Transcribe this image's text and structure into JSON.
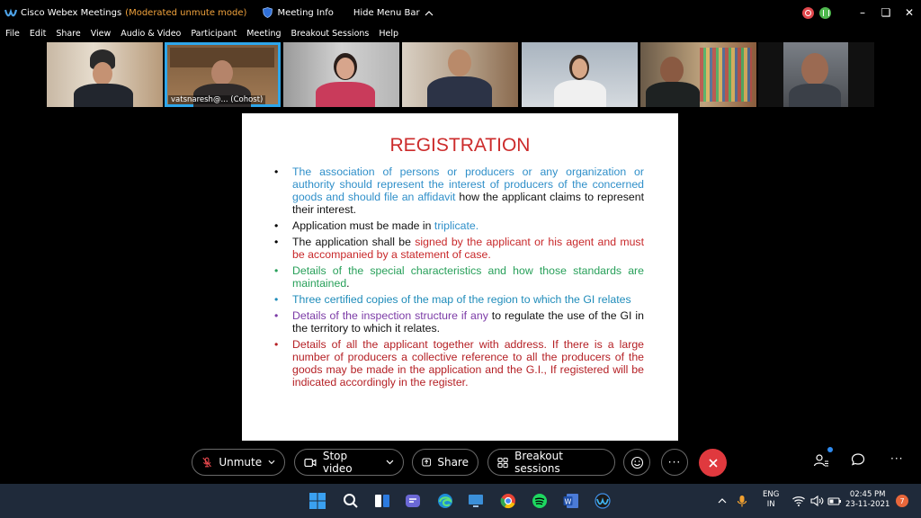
{
  "app": {
    "title": "Cisco Webex Meetings",
    "mode": "(Moderated unmute mode)",
    "meeting_info": "Meeting Info",
    "hide_menu": "Hide Menu Bar"
  },
  "menu": [
    "File",
    "Edit",
    "Share",
    "View",
    "Audio & Video",
    "Participant",
    "Meeting",
    "Breakout Sessions",
    "Help"
  ],
  "participants": {
    "active_label": "vatsnaresh@... (Cohost)"
  },
  "slide": {
    "title": "REGISTRATION",
    "bullets": [
      {
        "parts": [
          {
            "text": "The association of persons or producers or any organization or authority should represent the interest of producers of the concerned goods and should file an affidavit ",
            "color": "#2f8fc9"
          },
          {
            "text": "how the applicant claims to represent their interest.",
            "color": "#111111"
          }
        ]
      },
      {
        "parts": [
          {
            "text": "Application must be made in ",
            "color": "#111111"
          },
          {
            "text": "triplicate.",
            "color": "#2f8fc9"
          }
        ]
      },
      {
        "parts": [
          {
            "text": "The application shall be ",
            "color": "#111111"
          },
          {
            "text": "signed by the applicant or his agent and must be accompanied by a statement of case.",
            "color": "#c8282a"
          }
        ]
      },
      {
        "parts": [
          {
            "text": "Details of the special characteristics and how those standards are maintained",
            "color": "#28a05a"
          },
          {
            "text": ".",
            "color": "#111111"
          }
        ]
      },
      {
        "parts": [
          {
            "text": "Three certified copies of the map of the region to which the GI relates",
            "color": "#1f8cba"
          }
        ]
      },
      {
        "parts": [
          {
            "text": "Details of the inspection structure if any ",
            "color": "#7b3aa6"
          },
          {
            "text": "to regulate the use of the GI in the territory to which it relates.",
            "color": "#111111"
          }
        ]
      },
      {
        "parts": [
          {
            "text": "Details of all the applicant together with address. If there is a large number of producers a collective reference to all the producers of the goods may be made in the application and the G.I., If registered will be indicated accordingly in the register.",
            "color": "#b52025"
          }
        ]
      }
    ]
  },
  "controls": {
    "unmute": "Unmute",
    "stop_video": "Stop video",
    "share": "Share",
    "breakout": "Breakout sessions"
  },
  "taskbar": {
    "lang_line1": "ENG",
    "lang_line2": "IN",
    "time": "02:45 PM",
    "date": "23-11-2021",
    "notifications": "7"
  },
  "colors": {
    "accent": "#2ea6ea",
    "end_call": "#e0393e",
    "mode_text": "#f0a23c"
  }
}
